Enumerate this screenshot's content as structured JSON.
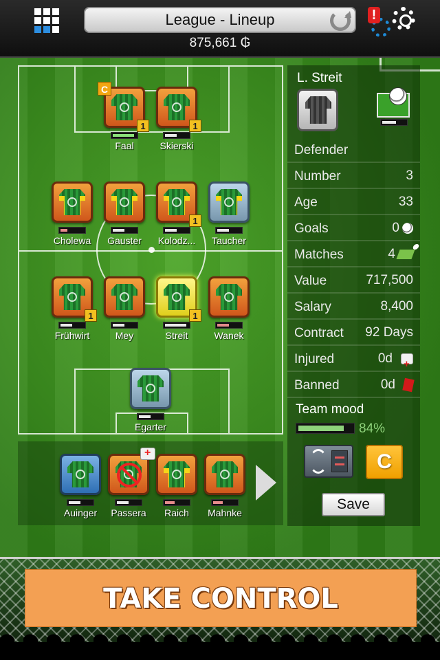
{
  "header": {
    "title": "League -  Lineup",
    "coins": "875,661 ₲",
    "alert": "!"
  },
  "lineup": {
    "forwards": [
      {
        "name": "Faal",
        "level": "1",
        "captain": "C",
        "fitness": 0.9,
        "fitness_color": "green"
      },
      {
        "name": "Skierski",
        "level": "1",
        "fitness": 0.5
      }
    ],
    "midfield": [
      {
        "name": "Cholewa",
        "fitness": 0.3,
        "fitness_color": "red"
      },
      {
        "name": "Gauster",
        "fitness": 0.5
      },
      {
        "name": "Kolodz...",
        "level": "1",
        "fitness": 0.5
      },
      {
        "name": "Taucher",
        "fitness": 0.5
      }
    ],
    "defense": [
      {
        "name": "Frühwirt",
        "level": "1",
        "fitness": 0.5
      },
      {
        "name": "Mey",
        "fitness": 0.5
      },
      {
        "name": "Streit",
        "level": "1",
        "fitness": 0.9,
        "selected": true
      },
      {
        "name": "Wanek",
        "fitness": 0.5,
        "fitness_color": "red"
      }
    ],
    "goalkeeper": {
      "name": "Egarter",
      "fitness": 0.5
    }
  },
  "bench": [
    {
      "name": "Auinger",
      "fitness": 0.5
    },
    {
      "name": "Passera",
      "fitness": 0.5,
      "injured": true
    },
    {
      "name": "Raich",
      "fitness": 0.4,
      "fitness_color": "red"
    },
    {
      "name": "Mahnke",
      "fitness": 0.4,
      "fitness_color": "red"
    }
  ],
  "player_panel": {
    "name": "L. Streit",
    "position": "Defender",
    "stats": [
      {
        "label": "Number",
        "value": "3"
      },
      {
        "label": "Age",
        "value": "33"
      },
      {
        "label": "Goals",
        "value": "0",
        "icon": "ball-icon"
      },
      {
        "label": "Matches",
        "value": "4",
        "icon": "pitch-icon"
      },
      {
        "label": "Value",
        "value": "717,500"
      },
      {
        "label": "Salary",
        "value": "8,400"
      },
      {
        "label": "Contract",
        "value": "92 Days"
      },
      {
        "label": "Injured",
        "value": "0d",
        "icon": "medkit-icon"
      },
      {
        "label": "Banned",
        "value": "0d",
        "icon": "red-card-icon"
      }
    ],
    "team_mood_label": "Team mood",
    "team_mood_value": "84%",
    "team_mood": 0.84,
    "captain_label": "C",
    "save_label": "Save"
  },
  "cta": {
    "label": "TAKE CONTROL"
  }
}
